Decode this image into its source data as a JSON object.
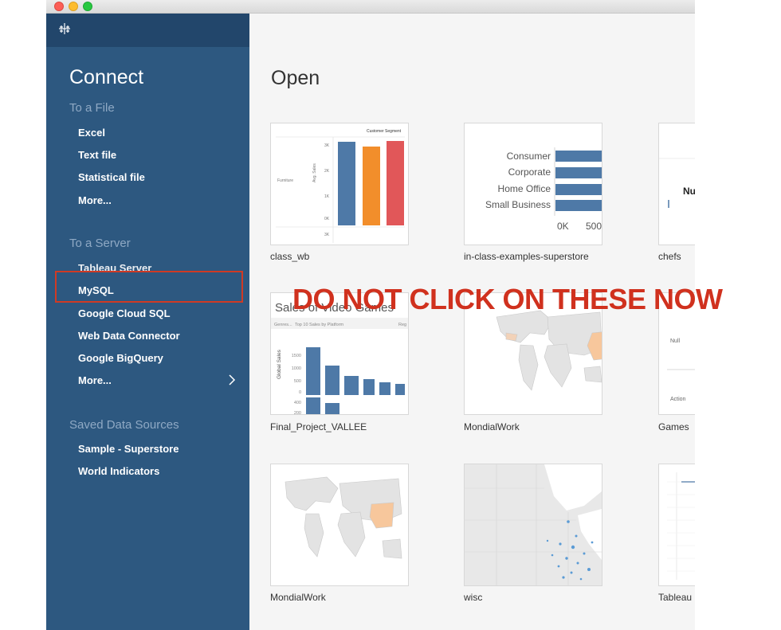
{
  "sidebar": {
    "connect_title": "Connect",
    "to_a_file_label": "To a File",
    "file_items": [
      "Excel",
      "Text file",
      "Statistical file",
      "More..."
    ],
    "to_a_server_label": "To a Server",
    "server_items": [
      "Tableau Server",
      "MySQL",
      "Google Cloud SQL",
      "Web Data Connector",
      "Google BigQuery",
      "More..."
    ],
    "saved_label": "Saved Data Sources",
    "saved_items": [
      "Sample - Superstore",
      "World Indicators"
    ]
  },
  "main": {
    "open_title": "Open",
    "workbooks": [
      {
        "name": "class_wb"
      },
      {
        "name": "in-class-examples-superstore"
      },
      {
        "name": "chefs"
      },
      {
        "name": "Final_Project_VALLEE"
      },
      {
        "name": "MondialWork"
      },
      {
        "name": "Games"
      },
      {
        "name": "MondialWork"
      },
      {
        "name": "wisc"
      },
      {
        "name": "Tableau"
      }
    ],
    "thumb1": {
      "title": "Customer Segment",
      "row_label": "Furniture",
      "axis_label": "Avg. Sales",
      "ticks": [
        "3K",
        "2K",
        "1K",
        "0K",
        "3K"
      ]
    },
    "thumb2": {
      "rows": [
        "Consumer",
        "Corporate",
        "Home Office",
        "Small Business"
      ],
      "axis": [
        "0K",
        "500"
      ]
    },
    "thumb3": {
      "text": "Nu"
    },
    "thumb4": {
      "title": "Sales of Video Games",
      "header_left": "Genres...",
      "header_mid": "Top 10 Sales by Platform",
      "header_right": "Reg",
      "axis_label": "Global Sales",
      "ticks": [
        "1500",
        "1000",
        "500",
        "0",
        "400",
        "200"
      ]
    },
    "thumb6": {
      "top": "Null",
      "bottom": "Action"
    }
  },
  "overlay": {
    "warning": "DO NOT CLICK ON THESE NOW"
  },
  "colors": {
    "sidebar": "#2d5880",
    "sidebar_top": "#22466b",
    "highlight": "#d03a24",
    "bar_blue": "#4e79a7",
    "bar_orange": "#f28e2b",
    "bar_red": "#e15759",
    "bar_teal": "#76b7b2"
  }
}
